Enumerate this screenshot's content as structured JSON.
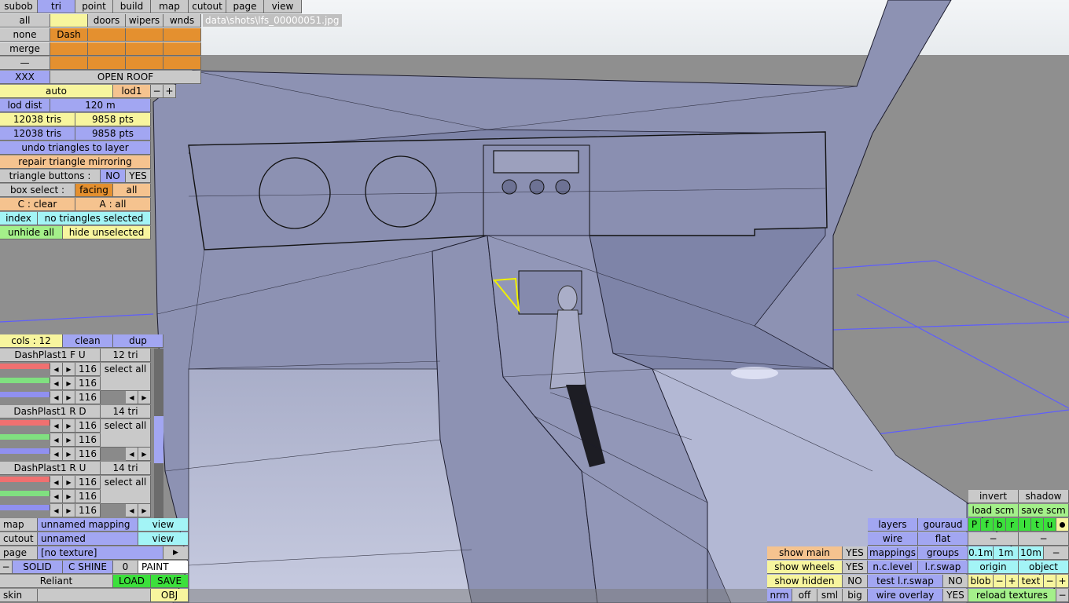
{
  "file_path": "data\\shots\\lfs_00000051.jpg",
  "menu": {
    "tabs": [
      "subob",
      "tri",
      "point",
      "build",
      "map",
      "cutout",
      "page",
      "view"
    ],
    "active_tab": "tri"
  },
  "subobject_panel": {
    "all": "all",
    "none": "none",
    "merge": "merge",
    "dash_entry": "—",
    "headers": [
      "doors",
      "wipers",
      "wnds"
    ],
    "dash": "Dash",
    "xxx": "XXX",
    "open_roof": "OPEN ROOF"
  },
  "lod": {
    "auto": "auto",
    "current": "lod1",
    "minus": "−",
    "plus": "+",
    "dist_label": "lod dist",
    "dist_value": "120 m"
  },
  "stats": {
    "tris_1": "12038 tris",
    "pts_1": "9858 pts",
    "tris_2": "12038 tris",
    "pts_2": "9858 pts"
  },
  "actions": {
    "undo": "undo triangles to layer",
    "repair": "repair triangle mirroring",
    "tri_buttons_label": "triangle buttons :",
    "tri_buttons_no": "NO",
    "tri_buttons_yes": "YES",
    "box_select_label": "box select :",
    "box_select_facing": "facing",
    "box_select_all": "all",
    "c_clear": "C : clear",
    "a_all": "A : all",
    "index": "index",
    "no_triangles": "no triangles selected",
    "unhide_all": "unhide all",
    "hide_unselected": "hide unselected"
  },
  "colors_panel": {
    "cols": "cols : 12",
    "clean": "clean",
    "dup": "dup",
    "groups": [
      {
        "name": "DashPlast1 F U",
        "tris": "12 tri",
        "values": [
          "116",
          "116",
          "116"
        ],
        "select_all": "select all"
      },
      {
        "name": "DashPlast1 R D",
        "tris": "14 tri",
        "values": [
          "116",
          "116",
          "116"
        ],
        "select_all": "select all"
      },
      {
        "name": "DashPlast1 R U",
        "tris": "14 tri",
        "values": [
          "116",
          "116",
          "116"
        ],
        "select_all": "select all"
      }
    ]
  },
  "bottom_left": {
    "map_label": "map",
    "map_value": "unnamed mapping",
    "map_view": "view",
    "cutout_label": "cutout",
    "cutout_value": "unnamed",
    "cutout_view": "view",
    "page_label": "page",
    "page_value": "[no texture]",
    "page_arrow": "▶",
    "dash": "−",
    "solid": "SOLID",
    "c_shine": "C SHINE",
    "zero": "0",
    "paint": "PAINT",
    "car_name": "Reliant",
    "load": "LOAD",
    "save": "SAVE",
    "skin": "skin",
    "obj": "OBJ"
  },
  "bottom_right": {
    "invert": "invert",
    "shadow": "shadow",
    "load_scm": "load scm",
    "save_scm": "save scm",
    "layer_letters": [
      "P",
      "f",
      "b",
      "r",
      "l",
      "t",
      "u"
    ],
    "layers": "layers",
    "gouraud": "gouraud",
    "wire": "wire",
    "flat": "flat",
    "dash": "−",
    "mappings": "mappings",
    "groups": "groups",
    "g1": "0.1m",
    "g2": "1m",
    "g3": "10m",
    "nc_level": "n.c.level",
    "lr_swap": "l.r.swap",
    "origin": "origin",
    "object": "object",
    "test_lr_swap": "test l.r.swap",
    "no": "NO",
    "blob": "blob",
    "minus": "−",
    "plus": "+",
    "text": "text",
    "wire_overlay": "wire overlay",
    "yes": "YES",
    "reload_textures": "reload textures",
    "show_main": "show main",
    "show_main_val": "YES",
    "show_wheels": "show wheels",
    "show_wheels_val": "YES",
    "show_hidden": "show hidden",
    "show_hidden_val": "NO",
    "nrm": "nrm",
    "off": "off",
    "sml": "sml",
    "big": "big"
  }
}
